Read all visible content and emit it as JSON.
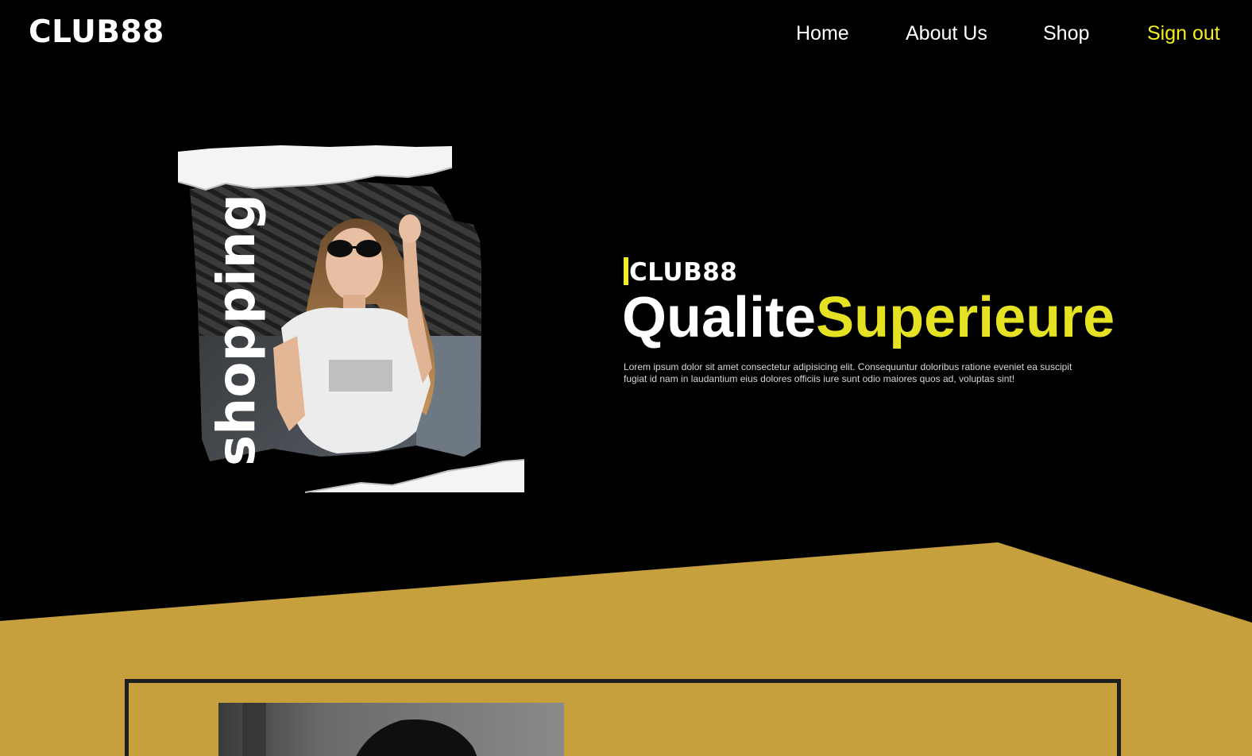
{
  "nav": {
    "brand": "CLUB88",
    "links": {
      "home": "Home",
      "about": "About Us",
      "shop": "Shop",
      "signout": "Sign out"
    }
  },
  "hero": {
    "image_word": "shopping",
    "kicker": "CLUB88",
    "title_white": "Qualite",
    "title_yellow": "Superieure",
    "description": "Lorem ipsum dolor sit amet consectetur adipisicing elit. Consequuntur doloribus ratione eveniet ea suscipit fugiat id nam in laudantium eius dolores officiis iure sunt odio maiores quos ad, voluptas sint!"
  },
  "colors": {
    "background": "#000000",
    "accent_yellow": "#f2ef1c",
    "gold": "#c7a03e",
    "text_white": "#ffffff"
  }
}
